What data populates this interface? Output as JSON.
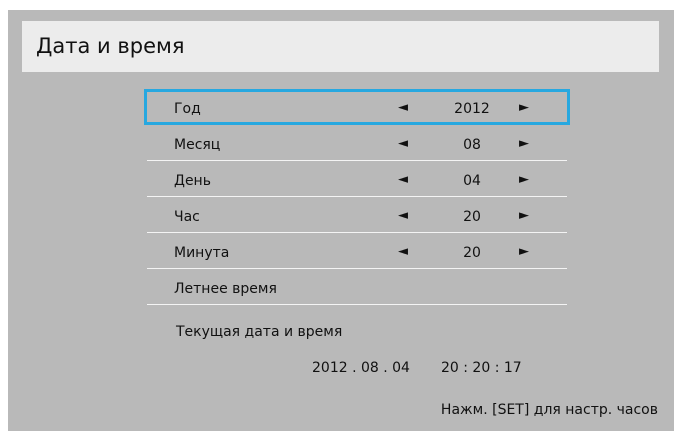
{
  "title": "Дата и время",
  "rows": [
    {
      "label": "Год",
      "value": "2012",
      "left_arrow": "◄",
      "right_arrow": "►"
    },
    {
      "label": "Месяц",
      "value": "08",
      "left_arrow": "◄",
      "right_arrow": "►"
    },
    {
      "label": "День",
      "value": "04",
      "left_arrow": "◄",
      "right_arrow": "►"
    },
    {
      "label": "Час",
      "value": "20",
      "left_arrow": "◄",
      "right_arrow": "►"
    },
    {
      "label": "Минута",
      "value": "20",
      "left_arrow": "◄",
      "right_arrow": "►"
    },
    {
      "label": "Летнее время"
    }
  ],
  "current": {
    "label": "Текущая дата и время",
    "date": "2012 . 08 . 04",
    "time": "20 : 20 : 17"
  },
  "hint": "Нажм. [SET] для настр. часов",
  "colors": {
    "panel": "#b9b9b9",
    "header": "#ececec",
    "highlight": "#27a8e0",
    "separator": "#f4f4f4"
  }
}
